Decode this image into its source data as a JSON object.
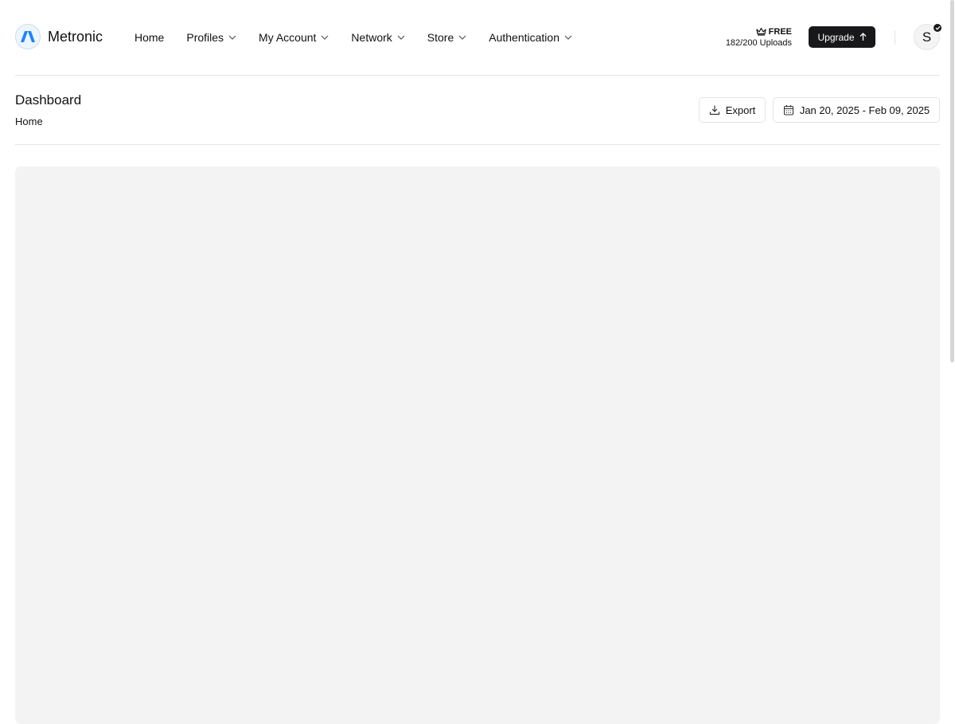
{
  "brand": {
    "name": "Metronic",
    "icon": "metronic-logo-icon",
    "accent": "#1b84ff"
  },
  "nav": {
    "items": [
      {
        "label": "Home",
        "has_dropdown": false
      },
      {
        "label": "Profiles",
        "has_dropdown": true
      },
      {
        "label": "My Account",
        "has_dropdown": true
      },
      {
        "label": "Network",
        "has_dropdown": true
      },
      {
        "label": "Store",
        "has_dropdown": true
      },
      {
        "label": "Authentication",
        "has_dropdown": true
      }
    ]
  },
  "plan": {
    "badge": "FREE",
    "badge_icon": "crown-icon",
    "uploads": "182/200 Uploads"
  },
  "upgrade": {
    "label": "Upgrade",
    "icon": "arrow-up-icon"
  },
  "user": {
    "initial": "S",
    "verified": true
  },
  "page": {
    "title": "Dashboard",
    "breadcrumb": "Home"
  },
  "toolbar": {
    "export_label": "Export",
    "export_icon": "download-icon",
    "date_range": "Jan 20, 2025 - Feb 09, 2025",
    "date_icon": "calendar-icon"
  }
}
